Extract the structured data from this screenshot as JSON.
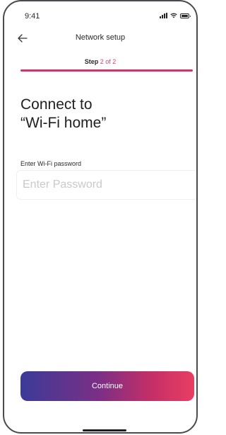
{
  "status_bar": {
    "time": "9:41",
    "icons": [
      "signal-icon",
      "wifi-icon",
      "battery-icon"
    ]
  },
  "nav": {
    "back_icon": "arrow-left-icon",
    "title": "Network setup"
  },
  "step": {
    "prefix": "Step",
    "current_label": "2 of 2",
    "current": 2,
    "total": 2,
    "progress_fraction": 1.0
  },
  "heading": {
    "line1": "Connect to",
    "line2": "“Wi-Fi home”"
  },
  "password_field": {
    "label": "Enter Wi-Fi password",
    "placeholder": "Enter Password",
    "value": ""
  },
  "continue_button": {
    "label": "Continue"
  },
  "colors": {
    "accent": "#d6336c",
    "progress_track": "#f1d0da",
    "gradient_start": "#3b3b98",
    "gradient_end": "#e83e63"
  }
}
